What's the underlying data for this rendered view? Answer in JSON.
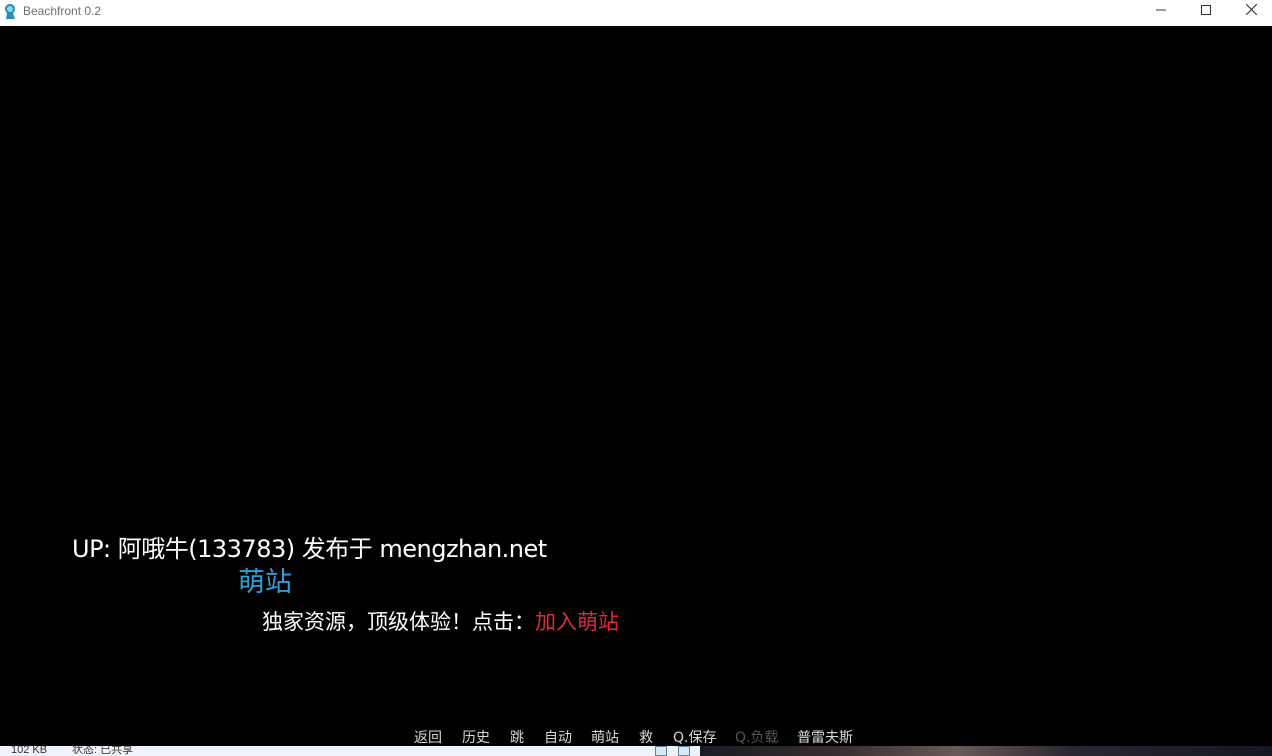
{
  "window": {
    "title": "Beachfront 0.2",
    "accent": "#2e9fd6"
  },
  "icons": {
    "app": "character-icon",
    "minimize": "minimize-icon",
    "maximize": "maximize-icon",
    "close": "close-icon"
  },
  "game": {
    "background": "#000000",
    "credit": "UP: 阿哦牛(133783) 发布于 mengzhan.net",
    "site_name": "萌站",
    "site_name_color": "#2e9fd6",
    "promo_text": "独家资源，顶级体验！点击：",
    "join_link": "加入萌站",
    "join_link_color": "#e0283c"
  },
  "quick_menu": {
    "items": [
      {
        "label": "返回",
        "enabled": true
      },
      {
        "label": "历史",
        "enabled": true
      },
      {
        "label": "跳",
        "enabled": true
      },
      {
        "label": "自动",
        "enabled": true
      },
      {
        "label": "萌站",
        "enabled": true
      },
      {
        "label": "救",
        "enabled": true
      },
      {
        "label": "Q.保存",
        "enabled": true
      },
      {
        "label": "Q.负载",
        "enabled": false
      },
      {
        "label": "普雷夫斯",
        "enabled": true
      }
    ]
  },
  "statusbar": {
    "size": "102 KB",
    "state": "状态: 已共享"
  }
}
